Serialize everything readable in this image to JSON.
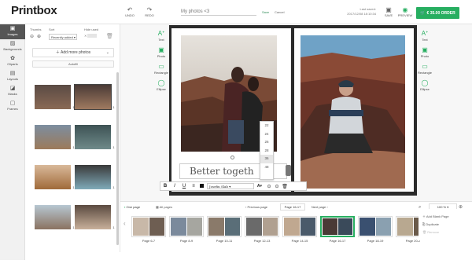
{
  "app": {
    "logo": "Printbox"
  },
  "header": {
    "undo": "UNDO",
    "redo": "REDO",
    "title": "My photos <3",
    "save": "Save",
    "cancel": "Cancel",
    "last_saved_label": "Last saved:",
    "last_saved_time": "2017/12/08 18:10:34",
    "save_btn": "SAVE",
    "preview_btn": "PREVIEW",
    "order_btn": "€ 35.00 ORDER"
  },
  "rail": [
    {
      "label": "Images",
      "icon": "images-icon",
      "active": true
    },
    {
      "label": "Backgrounds",
      "icon": "backgrounds-icon"
    },
    {
      "label": "Cliparts",
      "icon": "cliparts-icon"
    },
    {
      "label": "Layouts",
      "icon": "layouts-icon"
    },
    {
      "label": "Masks",
      "icon": "masks-icon"
    },
    {
      "label": "Frames",
      "icon": "frames-icon"
    }
  ],
  "panel": {
    "thumbs_label": "Thumbs",
    "sort_label": "Sort",
    "hide_used_label": "Hide used",
    "sort_value": "Recently added",
    "add_photos": "Add more photos",
    "autofill": "Autofill",
    "thumbs": [
      {
        "count": "1",
        "colors": [
          "#5a4a44",
          "#8a6a55"
        ]
      },
      {
        "count": "1",
        "colors": [
          "#4a3b36",
          "#a07a60"
        ]
      },
      {
        "count": "1",
        "colors": [
          "#7c8ea0",
          "#9c7a5a"
        ]
      },
      {
        "count": "1",
        "colors": [
          "#3d5254",
          "#6f8a8a"
        ]
      },
      {
        "count": "1",
        "colors": [
          "#d9b99a",
          "#a06a3a"
        ]
      },
      {
        "count": "1",
        "colors": [
          "#3a3a3a",
          "#7faab8"
        ]
      },
      {
        "count": "1",
        "colors": [
          "#b7c7d2",
          "#8a7260"
        ]
      },
      {
        "count": "1",
        "colors": [
          "#5a4a40",
          "#c8b09a"
        ]
      }
    ]
  },
  "tools": [
    {
      "label": "Text",
      "icon": "text-tool-icon"
    },
    {
      "label": "Photo",
      "icon": "photo-tool-icon"
    },
    {
      "label": "Rectangle",
      "icon": "rectangle-tool-icon"
    },
    {
      "label": "Ellipse",
      "icon": "ellipse-tool-icon"
    }
  ],
  "caption_text": "Better togeth",
  "text_toolbar": {
    "bold": "B",
    "italic": "I",
    "underline": "U",
    "font": "Josefin Slab",
    "size_icon": "A"
  },
  "size_options": [
    "22",
    "24",
    "26",
    "28",
    "36",
    "48"
  ],
  "size_selected": "36",
  "bottom": {
    "one_page": "One page",
    "all_pages": "All pages",
    "prev_page": "Previous page",
    "current_page": "Page 16-17",
    "next_page": "Next page",
    "pages": [
      {
        "label": "Page 6-7",
        "colors": [
          "#c8b8a8",
          "#6e5e52"
        ]
      },
      {
        "label": "Page 8-9",
        "colors": [
          "#7b8a9c",
          "#a6a6a0"
        ]
      },
      {
        "label": "Page 10-11",
        "colors": [
          "#8a7a6a",
          "#5a6e78"
        ]
      },
      {
        "label": "Page 12-13",
        "colors": [
          "#6a6a6a",
          "#b0a090"
        ]
      },
      {
        "label": "Page 14-15",
        "colors": [
          "#c0a890",
          "#4a5a6a"
        ]
      },
      {
        "label": "Page 16-17",
        "colors": [
          "#4a3a36",
          "#3a4a5a"
        ],
        "active": true
      },
      {
        "label": "Page 18-19",
        "colors": [
          "#3a5070",
          "#8aa0b0"
        ]
      },
      {
        "label": "Page 20-2",
        "colors": [
          "#b8a890",
          "#6a5a4a"
        ]
      }
    ],
    "zoom": "100 %",
    "menu_items": [
      "Add Blank Page",
      "Duplicate",
      "Remove"
    ]
  },
  "colors": {
    "accent": "#27ae60",
    "book": "#2b2b2b",
    "rail_active": "#555555"
  }
}
